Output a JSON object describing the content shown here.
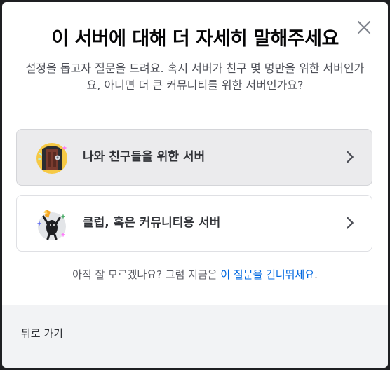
{
  "modal": {
    "title": "이 서버에 대해 더 자세히 말해주세요",
    "subtitle": "설정을 돕고자 질문을 드려요. 혹시 서버가 친구 몇 명만을 위한 서버인가요, 아니면 더 큰 커뮤니티를 위한 서버인가요?",
    "options": [
      {
        "label": "나와 친구들을 위한 서버",
        "icon": "friends-door-illustration"
      },
      {
        "label": "클럽, 혹은 커뮤니티용 서버",
        "icon": "club-cheer-illustration"
      }
    ],
    "skip_prefix": "아직 잘 모르겠나요? 그럼 지금은 ",
    "skip_link": "이 질문을 건너뛰세요",
    "skip_suffix": ".",
    "back_label": "뒤로 가기"
  },
  "colors": {
    "accent_link": "#0068e0",
    "title": "#060607",
    "footer_bg": "#f2f3f5",
    "option_hover_bg": "#ebebed"
  }
}
